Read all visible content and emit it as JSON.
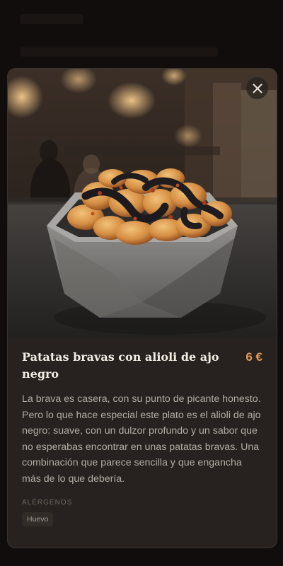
{
  "modal": {
    "image_alt": "Patatas bravas con alioli de ajo negro",
    "close_icon": "close-icon",
    "title": "Patatas bravas con alioli de ajo negro",
    "price": "6 €",
    "description": "La brava es casera, con su punto de picante honesto. Pero lo que hace especial este plato es el alioli de ajo negro: suave, con un dulzor profundo y un sabor que no esperabas encontrar en unas patatas bravas. Una combinación que parece sencilla y que engancha más de lo que debería.",
    "allergens_heading": "Alérgenos",
    "allergens": [
      "Huevo"
    ]
  },
  "colors": {
    "accent_price": "#e39a59",
    "modal_bg": "#27221f",
    "page_bg": "#110d0c"
  }
}
